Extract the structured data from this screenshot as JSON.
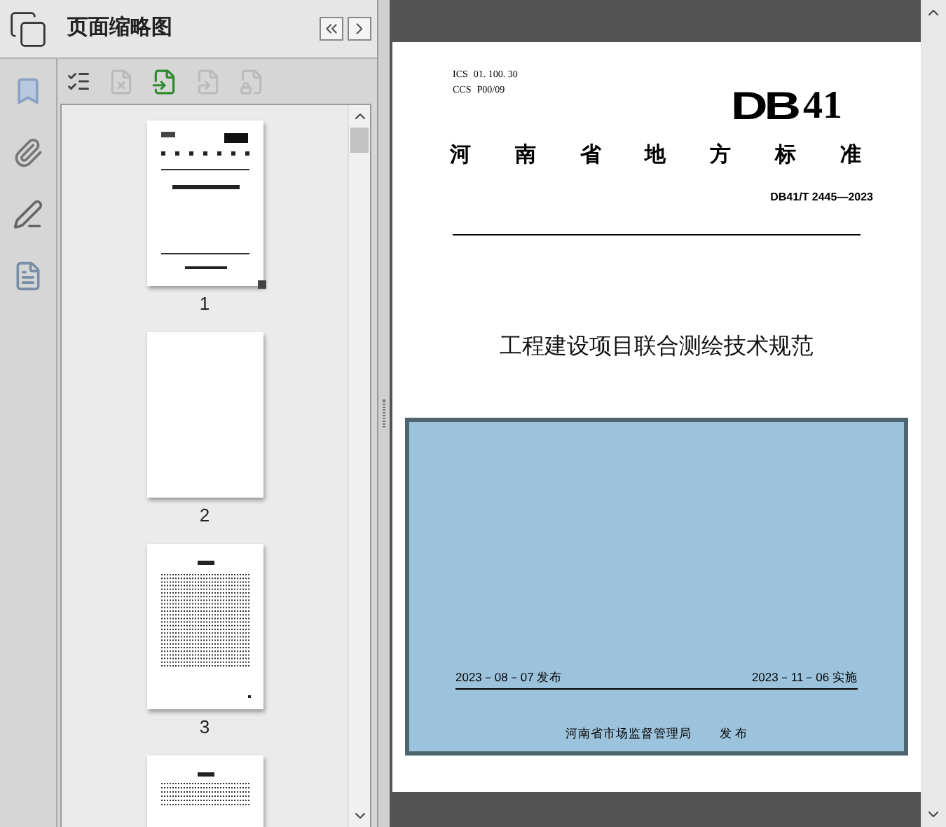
{
  "panel": {
    "title": "页面缩略图"
  },
  "nav_buttons": [
    {
      "kind": "first"
    },
    {
      "kind": "next"
    }
  ],
  "thumbnails": [
    {
      "label": "1",
      "kind": "cover",
      "view_handle": true
    },
    {
      "label": "2",
      "kind": "blank"
    },
    {
      "label": "3",
      "kind": "toc"
    },
    {
      "kind": "text"
    }
  ],
  "document": {
    "ics_label": "ICS",
    "ics": "01. 100. 30",
    "ccs_label": "CCS",
    "ccs": "P00/09",
    "code_bold": "DB",
    "code_number": "41",
    "category": "河南省地方标准",
    "number": "DB41/T 2445—2023",
    "title": "工程建设项目联合测绘技术规范",
    "publish_date": "2023－08－07 发布",
    "effective_date": "2023－11－06 实施",
    "issuer": "河南省市场监督管理局",
    "issue": "发 布"
  }
}
